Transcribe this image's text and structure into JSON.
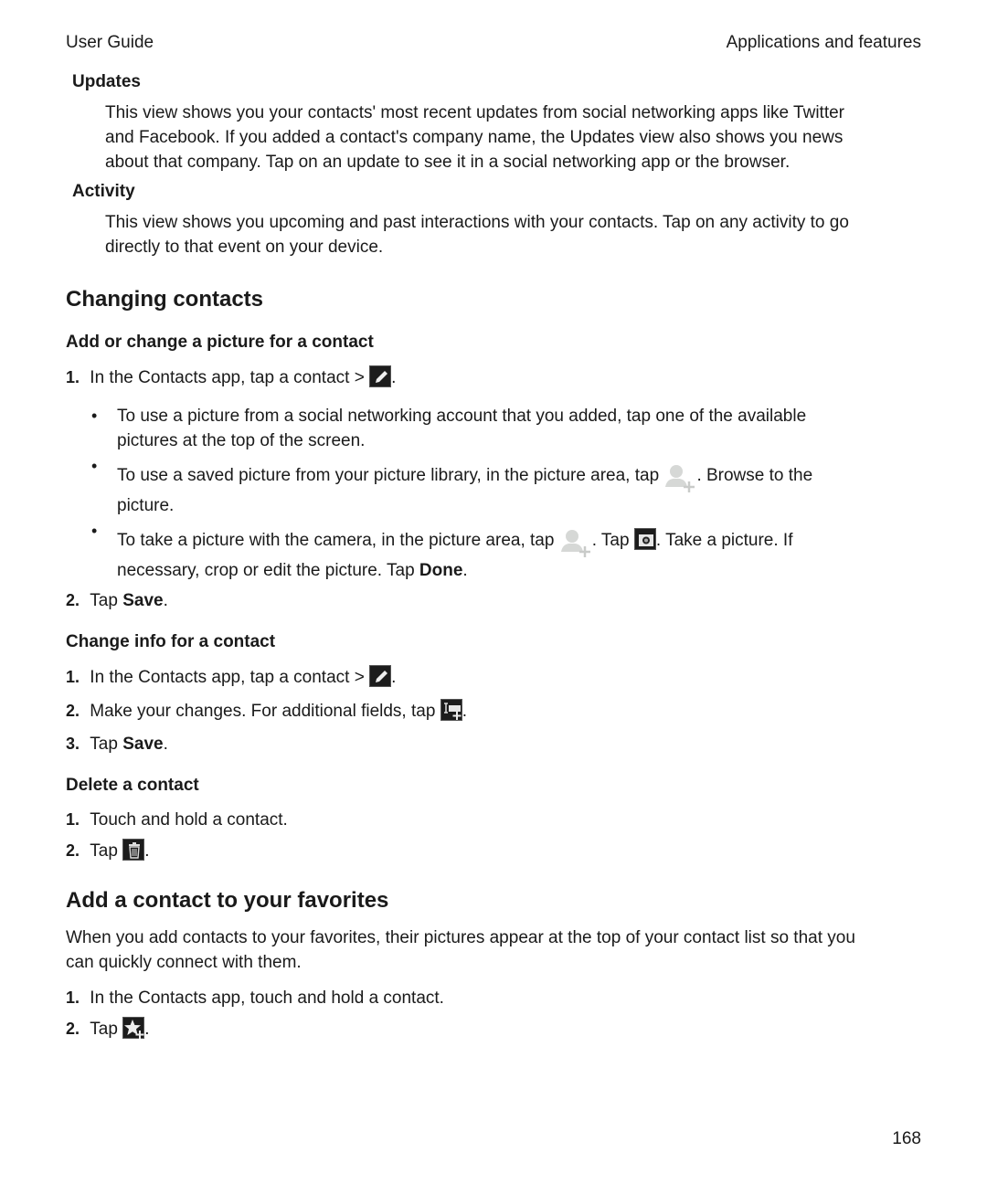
{
  "header": {
    "left": "User Guide",
    "right": "Applications and features"
  },
  "updates": {
    "title": "Updates",
    "lines": [
      "This view shows you your contacts' most recent updates from social networking apps like Twitter",
      "and Facebook. If you added a contact's company name, the Updates view also shows you news",
      "about that company. Tap on an update to see it in a social networking app or the browser."
    ]
  },
  "activity": {
    "title": "Activity",
    "lines": [
      "This view shows you upcoming and past interactions with your contacts. Tap on any activity to go",
      "directly to that event on your device."
    ]
  },
  "changing": {
    "title": "Changing contacts",
    "picture": {
      "title": "Add or change a picture for a contact",
      "step1_num": "1.",
      "step1_text": "In the Contacts app, tap a contact >",
      "b1_l1": "To use a picture from a social networking account that you added, tap one of the available",
      "b1_l2": "pictures at the top of the screen.",
      "b2_a": "To use a saved picture from your picture library, in the picture area, tap",
      "b2_b": ". Browse to the",
      "b2_l2": "picture.",
      "b3_a": "To take a picture with the camera, in the picture area, tap",
      "b3_b": ". Tap",
      "b3_c": ". Take a picture. If",
      "b3_l2a": "necessary, crop or edit the picture. Tap ",
      "b3_l2b": "Done",
      "step2_num": "2.",
      "step2_a": "Tap ",
      "step2_b": "Save"
    },
    "info": {
      "title": "Change info for a contact",
      "s1_num": "1.",
      "s1_text": "In the Contacts app, tap a contact >",
      "s2_num": "2.",
      "s2_text": "Make your changes. For additional fields, tap",
      "s3_num": "3.",
      "s3_a": "Tap ",
      "s3_b": "Save"
    },
    "delete": {
      "title": "Delete a contact",
      "s1_num": "1.",
      "s1_text": "Touch and hold a contact.",
      "s2_num": "2.",
      "s2_text": "Tap"
    }
  },
  "favorites": {
    "title": "Add a contact to your favorites",
    "intro_l1": "When you add contacts to your favorites, their pictures appear at the top of your contact list so that you",
    "intro_l2": "can quickly connect with them.",
    "s1_num": "1.",
    "s1_text": "In the Contacts app, touch and hold a contact.",
    "s2_num": "2.",
    "s2_text": "Tap"
  },
  "icons": {
    "edit": "pencil-icon",
    "add_picture": "add-contact-picture-icon",
    "camera": "camera-icon",
    "add_field": "add-field-icon",
    "delete": "trash-icon",
    "favorite": "add-favorite-star-icon"
  },
  "page_number": "168"
}
